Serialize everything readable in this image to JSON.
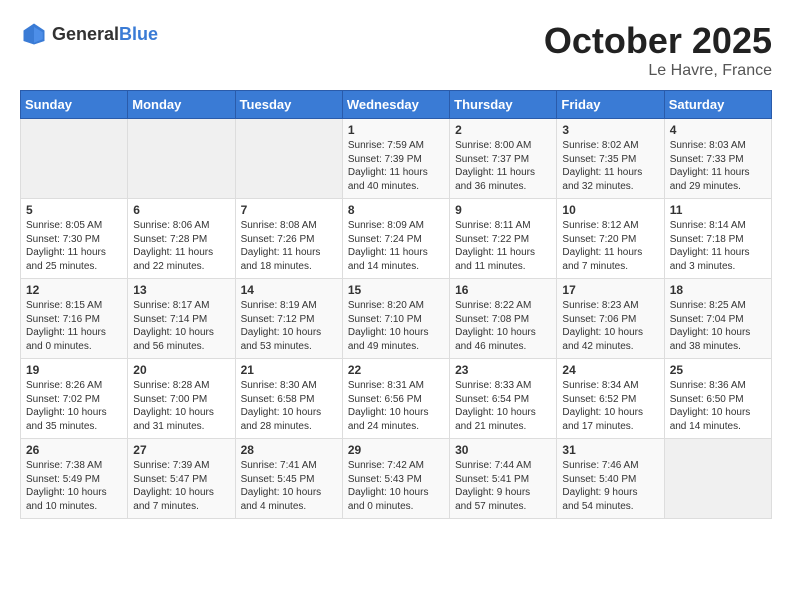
{
  "logo": {
    "text_general": "General",
    "text_blue": "Blue"
  },
  "title": {
    "month": "October 2025",
    "location": "Le Havre, France"
  },
  "weekdays": [
    "Sunday",
    "Monday",
    "Tuesday",
    "Wednesday",
    "Thursday",
    "Friday",
    "Saturday"
  ],
  "weeks": [
    [
      {
        "day": "",
        "info": ""
      },
      {
        "day": "",
        "info": ""
      },
      {
        "day": "",
        "info": ""
      },
      {
        "day": "1",
        "info": "Sunrise: 7:59 AM\nSunset: 7:39 PM\nDaylight: 11 hours\nand 40 minutes."
      },
      {
        "day": "2",
        "info": "Sunrise: 8:00 AM\nSunset: 7:37 PM\nDaylight: 11 hours\nand 36 minutes."
      },
      {
        "day": "3",
        "info": "Sunrise: 8:02 AM\nSunset: 7:35 PM\nDaylight: 11 hours\nand 32 minutes."
      },
      {
        "day": "4",
        "info": "Sunrise: 8:03 AM\nSunset: 7:33 PM\nDaylight: 11 hours\nand 29 minutes."
      }
    ],
    [
      {
        "day": "5",
        "info": "Sunrise: 8:05 AM\nSunset: 7:30 PM\nDaylight: 11 hours\nand 25 minutes."
      },
      {
        "day": "6",
        "info": "Sunrise: 8:06 AM\nSunset: 7:28 PM\nDaylight: 11 hours\nand 22 minutes."
      },
      {
        "day": "7",
        "info": "Sunrise: 8:08 AM\nSunset: 7:26 PM\nDaylight: 11 hours\nand 18 minutes."
      },
      {
        "day": "8",
        "info": "Sunrise: 8:09 AM\nSunset: 7:24 PM\nDaylight: 11 hours\nand 14 minutes."
      },
      {
        "day": "9",
        "info": "Sunrise: 8:11 AM\nSunset: 7:22 PM\nDaylight: 11 hours\nand 11 minutes."
      },
      {
        "day": "10",
        "info": "Sunrise: 8:12 AM\nSunset: 7:20 PM\nDaylight: 11 hours\nand 7 minutes."
      },
      {
        "day": "11",
        "info": "Sunrise: 8:14 AM\nSunset: 7:18 PM\nDaylight: 11 hours\nand 3 minutes."
      }
    ],
    [
      {
        "day": "12",
        "info": "Sunrise: 8:15 AM\nSunset: 7:16 PM\nDaylight: 11 hours\nand 0 minutes."
      },
      {
        "day": "13",
        "info": "Sunrise: 8:17 AM\nSunset: 7:14 PM\nDaylight: 10 hours\nand 56 minutes."
      },
      {
        "day": "14",
        "info": "Sunrise: 8:19 AM\nSunset: 7:12 PM\nDaylight: 10 hours\nand 53 minutes."
      },
      {
        "day": "15",
        "info": "Sunrise: 8:20 AM\nSunset: 7:10 PM\nDaylight: 10 hours\nand 49 minutes."
      },
      {
        "day": "16",
        "info": "Sunrise: 8:22 AM\nSunset: 7:08 PM\nDaylight: 10 hours\nand 46 minutes."
      },
      {
        "day": "17",
        "info": "Sunrise: 8:23 AM\nSunset: 7:06 PM\nDaylight: 10 hours\nand 42 minutes."
      },
      {
        "day": "18",
        "info": "Sunrise: 8:25 AM\nSunset: 7:04 PM\nDaylight: 10 hours\nand 38 minutes."
      }
    ],
    [
      {
        "day": "19",
        "info": "Sunrise: 8:26 AM\nSunset: 7:02 PM\nDaylight: 10 hours\nand 35 minutes."
      },
      {
        "day": "20",
        "info": "Sunrise: 8:28 AM\nSunset: 7:00 PM\nDaylight: 10 hours\nand 31 minutes."
      },
      {
        "day": "21",
        "info": "Sunrise: 8:30 AM\nSunset: 6:58 PM\nDaylight: 10 hours\nand 28 minutes."
      },
      {
        "day": "22",
        "info": "Sunrise: 8:31 AM\nSunset: 6:56 PM\nDaylight: 10 hours\nand 24 minutes."
      },
      {
        "day": "23",
        "info": "Sunrise: 8:33 AM\nSunset: 6:54 PM\nDaylight: 10 hours\nand 21 minutes."
      },
      {
        "day": "24",
        "info": "Sunrise: 8:34 AM\nSunset: 6:52 PM\nDaylight: 10 hours\nand 17 minutes."
      },
      {
        "day": "25",
        "info": "Sunrise: 8:36 AM\nSunset: 6:50 PM\nDaylight: 10 hours\nand 14 minutes."
      }
    ],
    [
      {
        "day": "26",
        "info": "Sunrise: 7:38 AM\nSunset: 5:49 PM\nDaylight: 10 hours\nand 10 minutes."
      },
      {
        "day": "27",
        "info": "Sunrise: 7:39 AM\nSunset: 5:47 PM\nDaylight: 10 hours\nand 7 minutes."
      },
      {
        "day": "28",
        "info": "Sunrise: 7:41 AM\nSunset: 5:45 PM\nDaylight: 10 hours\nand 4 minutes."
      },
      {
        "day": "29",
        "info": "Sunrise: 7:42 AM\nSunset: 5:43 PM\nDaylight: 10 hours\nand 0 minutes."
      },
      {
        "day": "30",
        "info": "Sunrise: 7:44 AM\nSunset: 5:41 PM\nDaylight: 9 hours\nand 57 minutes."
      },
      {
        "day": "31",
        "info": "Sunrise: 7:46 AM\nSunset: 5:40 PM\nDaylight: 9 hours\nand 54 minutes."
      },
      {
        "day": "",
        "info": ""
      }
    ]
  ]
}
